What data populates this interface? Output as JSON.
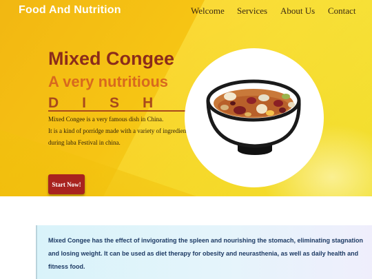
{
  "nav": {
    "brand": "Food And Nutrition",
    "links": [
      "Welcome",
      "Services",
      "About Us",
      "Contact"
    ]
  },
  "hero": {
    "title": "Mixed Congee",
    "subtitle": "A very nutritious",
    "dish_word": "DISH",
    "description": [
      "Mixed Congee is a very famous dish in China.",
      "It is a kind of porridge made with a variety of ingredients",
      "during laba Festival in china."
    ],
    "cta_label": "Start Now!",
    "image_icon": "congee-bowl-icon"
  },
  "info": {
    "lines": [
      "Mixed Congee has the effect of invigorating the spleen and nourishing the stomach, eliminating stagnation",
      "and losing weight. It can be used as diet therapy for obesity and neurasthenia, as well as daily health and",
      "fitness food."
    ]
  },
  "colors": {
    "hero_yellow": "#f6c414",
    "title": "#8b2c1b",
    "subtitle": "#d8691e",
    "button": "#a8231f",
    "info_text": "#1d3a64"
  }
}
